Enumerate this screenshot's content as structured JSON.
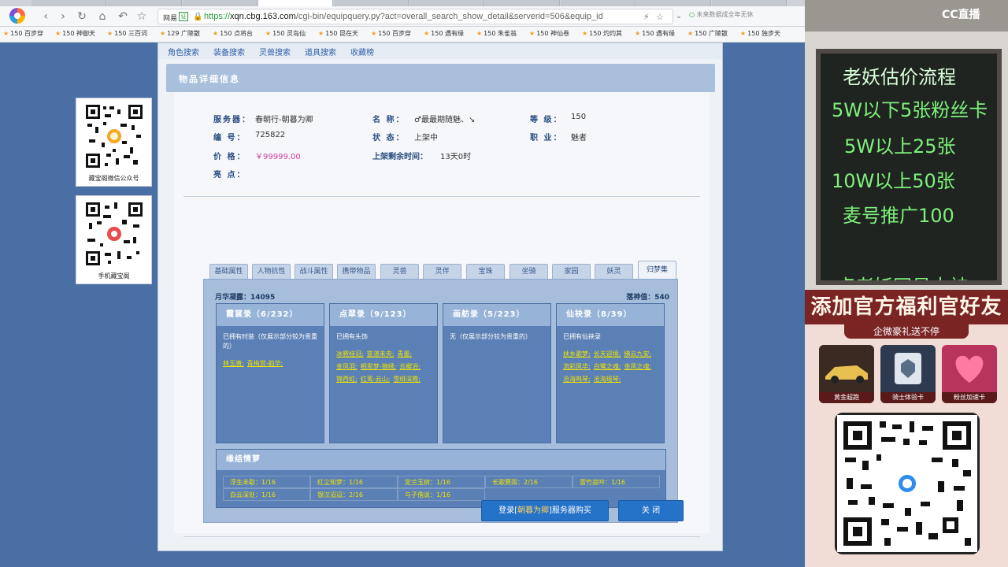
{
  "browser": {
    "tabs": [
      "",
      "",
      "",
      "",
      "",
      "",
      "",
      "",
      "",
      ""
    ],
    "site_label": "网易",
    "url_badge": "证",
    "url_prefix": "https://",
    "url_domain": "xqn.cbg.163.com",
    "url_path": "/cgi-bin/equipquery.py?act=overall_search_show_detail&serverid=506&equip_id",
    "search_placeholder": "未来数据成全年无休"
  },
  "bookmarks": [
    "150 百步穿",
    "150 神御天",
    "150 三百词",
    "129 广陵散",
    "150 点将台",
    "150 灵岛仙",
    "150 昆在天",
    "150 百步穿",
    "150 遇有缘",
    "150 朱雀翁",
    "150 神仙卷",
    "150 灼灼其",
    "150 遇有缘",
    "150 广陵散",
    "150 独步天"
  ],
  "topnav": [
    "角色搜索",
    "装备搜索",
    "灵兽搜索",
    "道具搜索",
    "收藏榜"
  ],
  "detail_title": "物品详细信息",
  "info": {
    "server_label": "服务器：",
    "server_value": "春朝行-朝暮为卿",
    "name_label": "名  称：",
    "name_value": "♂最最期随魅、↘",
    "level_label": "等  级：",
    "level_value": "150",
    "id_label": "编  号：",
    "id_value": "725822",
    "status_label": "状  态：",
    "status_value": "上架中",
    "job_label": "职  业：",
    "job_value": "魅者",
    "price_label": "价  格：",
    "price_value": "￥99999.00",
    "remain_label": "上架剩余时间：",
    "remain_value": "13天0时",
    "highlight_label": "亮  点："
  },
  "tabs": [
    "基础属性",
    "人物抗性",
    "战斗属性",
    "携带物品",
    "灵兽",
    "灵伴",
    "宝珠",
    "坐骑",
    "家园",
    "妖灵",
    "归梦集"
  ],
  "moon_label": "月华凝露：14095",
  "dream_label": "落神值：540",
  "books": [
    {
      "title": "霞裳录（6/232）",
      "desc": "已拥有时装（仅展示部分较为贵重的）",
      "items": [
        "林玉唐;",
        "青梅赏-韵华;"
      ]
    },
    {
      "title": "点翠录（9/123）",
      "desc": "已拥有头饰",
      "items": [
        "冰霓桂冠;",
        "篮湛未央;",
        "青墨;",
        "金凤羽;",
        "相思梦-锦绣;",
        "云樨浴;",
        "锦西虹;",
        "红鸾-云山;",
        "雪绯深霞;"
      ]
    },
    {
      "title": "画舫录（5/223）",
      "desc": "无（仅展示部分较为贵重的）",
      "items": []
    },
    {
      "title": "仙袂录（8/39）",
      "desc": "已拥有仙袂录",
      "items": [
        "扶乡歌梦;",
        "长天迎境;",
        "拂云九安;",
        "流彩凤华;",
        "白鹭之魂;",
        "金凤之魂;",
        "沧海鸣琴;",
        "沧海瑶琴;"
      ]
    }
  ],
  "bond_title": "缘结情萝",
  "bonds": [
    "浮生未歇：1/16",
    "红尘知梦：1/16",
    "定兰玉树：1/16",
    "长歌赛雨：2/16",
    "雷竹寂吟：1/16",
    "白云深处：1/16",
    "银汉迢迢：2/16",
    "与子偕说：1/16"
  ],
  "buttons": {
    "buy_pre": "登录[",
    "buy_server": "朝暮为卿",
    "buy_post": "]服务器购买",
    "close": "关    闭"
  },
  "qr": {
    "wechat_caption": "藏宝阁微信公众号",
    "mobile_caption": "手机藏宝阁"
  },
  "stream": {
    "logo": "CC直播",
    "board_lines": [
      "老妖估价流程",
      "5W以下5张粉丝卡",
      "5W以上25张",
      "10W以上50张",
      "麦号推广100",
      "点老妖网易大神"
    ],
    "promo_title": "添加官方福利官好友",
    "promo_sub": "企微豪礼送不停",
    "gifts": [
      "黄金超跑",
      "骑士体验卡",
      "粉丝加速卡"
    ]
  },
  "colors": {
    "accent": "#2572c9",
    "price": "#d23fa3",
    "item_link": "#f0e400",
    "chalk_green": "#7ef07a"
  }
}
